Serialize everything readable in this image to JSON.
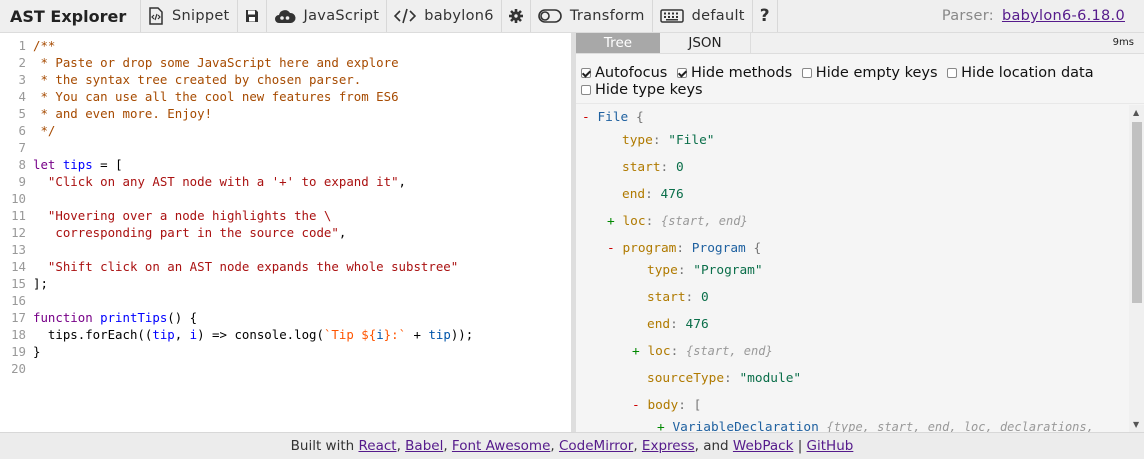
{
  "toolbar": {
    "title": "AST Explorer",
    "snippet": "Snippet",
    "language": "JavaScript",
    "parser": "babylon6",
    "transform": "Transform",
    "keymap": "default",
    "help": "?",
    "parser_info_label": "Parser:",
    "parser_info_link": "babylon6-6.18.0"
  },
  "editor": {
    "lines": [
      {
        "n": "1",
        "t": [
          [
            "c-comment",
            "/**"
          ]
        ]
      },
      {
        "n": "2",
        "t": [
          [
            "c-comment",
            " * Paste or drop some JavaScript here and explore"
          ]
        ]
      },
      {
        "n": "3",
        "t": [
          [
            "c-comment",
            " * the syntax tree created by chosen parser."
          ]
        ]
      },
      {
        "n": "4",
        "t": [
          [
            "c-comment",
            " * You can use all the cool new features from ES6"
          ]
        ]
      },
      {
        "n": "5",
        "t": [
          [
            "c-comment",
            " * and even more. Enjoy!"
          ]
        ]
      },
      {
        "n": "6",
        "t": [
          [
            "c-comment",
            " */"
          ]
        ]
      },
      {
        "n": "7",
        "t": []
      },
      {
        "n": "8",
        "t": [
          [
            "c-kw",
            "let "
          ],
          [
            "c-def",
            "tips"
          ],
          [
            "c-plain",
            " = ["
          ]
        ]
      },
      {
        "n": "9",
        "t": [
          [
            "c-plain",
            "  "
          ],
          [
            "c-str",
            "\"Click on any AST node with a '+' to expand it\""
          ],
          [
            "c-plain",
            ","
          ]
        ]
      },
      {
        "n": "10",
        "t": []
      },
      {
        "n": "11",
        "t": [
          [
            "c-plain",
            "  "
          ],
          [
            "c-str",
            "\"Hovering over a node highlights the \\"
          ]
        ]
      },
      {
        "n": "12",
        "t": [
          [
            "c-str",
            "   corresponding part in the source code\""
          ],
          [
            "c-plain",
            ","
          ]
        ]
      },
      {
        "n": "13",
        "t": []
      },
      {
        "n": "14",
        "t": [
          [
            "c-plain",
            "  "
          ],
          [
            "c-str",
            "\"Shift click on an AST node expands the whole substree\""
          ]
        ]
      },
      {
        "n": "15",
        "t": [
          [
            "c-plain",
            "];"
          ]
        ]
      },
      {
        "n": "16",
        "t": []
      },
      {
        "n": "17",
        "t": [
          [
            "c-kw",
            "function "
          ],
          [
            "c-def",
            "printTips"
          ],
          [
            "c-plain",
            "() {"
          ]
        ]
      },
      {
        "n": "18",
        "t": [
          [
            "c-plain",
            "  tips.forEach(("
          ],
          [
            "c-def",
            "tip"
          ],
          [
            "c-plain",
            ", "
          ],
          [
            "c-def",
            "i"
          ],
          [
            "c-plain",
            ") => console.log("
          ],
          [
            "c-str2",
            "`Tip ${"
          ],
          [
            "c-var2",
            "i"
          ],
          [
            "c-str2",
            "}:`"
          ],
          [
            "c-plain",
            " + "
          ],
          [
            "c-var2",
            "tip"
          ],
          [
            "c-plain",
            "));"
          ]
        ]
      },
      {
        "n": "19",
        "t": [
          [
            "c-plain",
            "}"
          ]
        ]
      },
      {
        "n": "20",
        "t": []
      }
    ]
  },
  "output": {
    "tabs": [
      "Tree",
      "JSON"
    ],
    "timing": "9ms",
    "options": [
      {
        "label": "Autofocus",
        "checked": true
      },
      {
        "label": "Hide methods",
        "checked": true
      },
      {
        "label": "Hide empty keys",
        "checked": false
      },
      {
        "label": "Hide location data",
        "checked": false
      },
      {
        "label": "Hide type keys",
        "checked": false
      }
    ],
    "tree": [
      {
        "toggle": "-",
        "parts": [
          [
            "t-type",
            "File"
          ],
          [
            "t-brace",
            " {"
          ]
        ]
      },
      {
        "parts": [
          [
            "t-key",
            "type"
          ],
          [
            "t-brace",
            ": "
          ],
          [
            "t-str",
            "\"File\""
          ]
        ]
      },
      {
        "parts": [
          [
            "t-key",
            "start"
          ],
          [
            "t-brace",
            ": "
          ],
          [
            "t-num",
            "0"
          ]
        ]
      },
      {
        "parts": [
          [
            "t-key",
            "end"
          ],
          [
            "t-brace",
            ": "
          ],
          [
            "t-num",
            "476"
          ]
        ]
      },
      {
        "toggle": "+",
        "parts": [
          [
            "t-key",
            "loc"
          ],
          [
            "t-brace",
            ": "
          ],
          [
            "t-summary",
            "{start, end}"
          ]
        ]
      },
      {
        "toggle": "-",
        "parts": [
          [
            "t-key",
            "program"
          ],
          [
            "t-brace",
            ": "
          ],
          [
            "t-type",
            "Program"
          ],
          [
            "t-brace",
            " {"
          ]
        ]
      },
      {
        "parts": [
          [
            "t-key",
            "type"
          ],
          [
            "t-brace",
            ": "
          ],
          [
            "t-str",
            "\"Program\""
          ]
        ]
      },
      {
        "parts": [
          [
            "t-key",
            "start"
          ],
          [
            "t-brace",
            ": "
          ],
          [
            "t-num",
            "0"
          ]
        ]
      },
      {
        "parts": [
          [
            "t-key",
            "end"
          ],
          [
            "t-brace",
            ": "
          ],
          [
            "t-num",
            "476"
          ]
        ]
      },
      {
        "toggle": "+",
        "parts": [
          [
            "t-key",
            "loc"
          ],
          [
            "t-brace",
            ": "
          ],
          [
            "t-summary",
            "{start, end}"
          ]
        ]
      },
      {
        "parts": [
          [
            "t-key",
            "sourceType"
          ],
          [
            "t-brace",
            ": "
          ],
          [
            "t-str",
            "\"module\""
          ]
        ]
      },
      {
        "toggle": "-",
        "parts": [
          [
            "t-key",
            "body"
          ],
          [
            "t-brace",
            ": ["
          ]
        ]
      },
      {
        "toggle": "+",
        "parts": [
          [
            "t-type",
            "VariableDeclaration"
          ],
          [
            "t-brace",
            " "
          ],
          [
            "t-summary",
            "{type, start, end, loc, declarations, "
          ]
        ]
      }
    ]
  },
  "footer": {
    "prefix": "Built with ",
    "links": [
      "React",
      "Babel",
      "Font Awesome",
      "CodeMirror",
      "Express"
    ],
    "and": ", and ",
    "webpack": "WebPack",
    "sep": " | ",
    "github": "GitHub"
  }
}
